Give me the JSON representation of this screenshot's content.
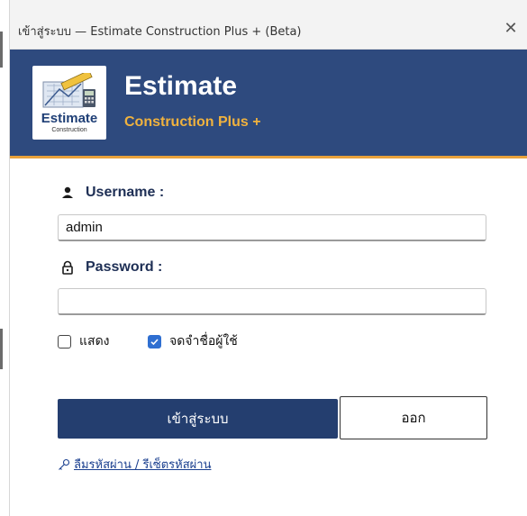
{
  "window": {
    "title": "เข้าสู่ระบบ — Estimate Construction Plus + (Beta)",
    "close_glyph": "✕"
  },
  "brand": {
    "logo_word": "Estimate",
    "logo_sub": "Construction",
    "title": "Estimate",
    "subtitle": "Construction Plus +",
    "colors": {
      "banner": "#2e4a7e",
      "accent": "#f0b23e",
      "stripe": "#e9a23b"
    }
  },
  "form": {
    "username_label": "Username :",
    "username_value": "admin",
    "password_label": "Password :",
    "password_value": "",
    "show_label": "แสดง",
    "show_checked": false,
    "remember_label": "จดจำชื่อผู้ใช้",
    "remember_checked": true
  },
  "actions": {
    "login_label": "เข้าสู่ระบบ",
    "exit_label": "ออก",
    "forgot_label": "ลืมรหัสผ่าน / รีเซ็ตรหัสผ่าน"
  },
  "icons": {
    "username": "user-icon",
    "password": "lock-icon",
    "forgot": "key-icon",
    "check": "checkmark-icon"
  }
}
